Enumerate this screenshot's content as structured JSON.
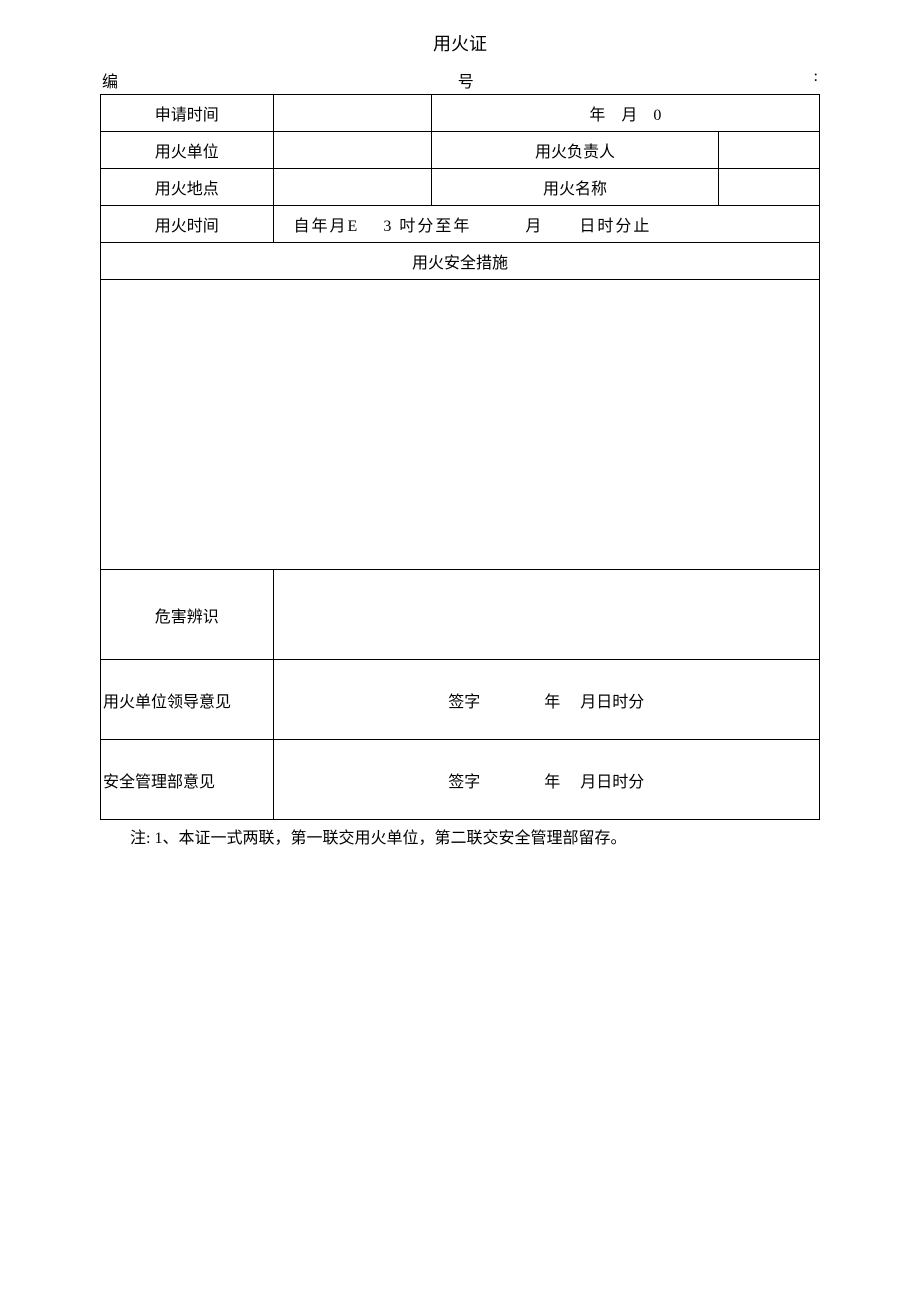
{
  "title": "用火证",
  "serial": {
    "left": "编",
    "mid": "号",
    "right": ":"
  },
  "rows": {
    "r1": {
      "c1": "申请时间",
      "c2": "",
      "c3_year": "年",
      "c3_month": "月",
      "c3_zero": "0"
    },
    "r2": {
      "c1": "用火单位",
      "c2": "",
      "c3": "用火负责人",
      "c4": ""
    },
    "r3": {
      "c1": "用火地点",
      "c2": "",
      "c3": "用火名称",
      "c4": ""
    },
    "r4": {
      "c1": "用火时间",
      "c2": "自年月E　 3 吋分至年　　　月　　日时分止"
    },
    "safety_header": "用火安全措施",
    "hazard": {
      "c1": "危害辨识",
      "c2": ""
    },
    "opinion1": {
      "c1": "用火单位领导意见",
      "c2": "签字　　　　年　  月日时分"
    },
    "opinion2": {
      "c1": "安全管理部意见",
      "c2": "签字　　　　年　  月日时分"
    }
  },
  "note": "注: 1、本证一式两联，第一联交用火单位，第二联交安全管理部留存。"
}
